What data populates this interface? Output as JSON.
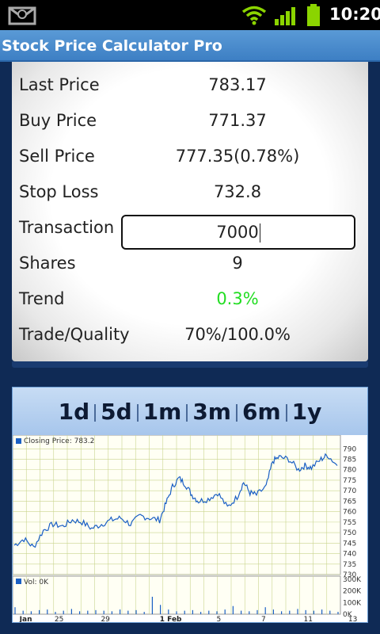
{
  "status_bar": {
    "time": "10:20",
    "icons": [
      "notification-icon",
      "wifi-icon",
      "signal-icon",
      "battery-icon"
    ]
  },
  "app": {
    "title": "Stock Price Calculator Pro"
  },
  "info": {
    "rows": [
      {
        "label": "Last Price",
        "value": "783.17"
      },
      {
        "label": "Buy Price",
        "value": "771.37"
      },
      {
        "label": "Sell Price",
        "value": "777.35(0.78%)"
      },
      {
        "label": "Stop Loss",
        "value": "732.8"
      },
      {
        "label": "Transaction",
        "value": "7000"
      },
      {
        "label": "Shares",
        "value": "9"
      },
      {
        "label": "Trend",
        "value": "0.3%",
        "color": "#22dd22"
      },
      {
        "label": "Trade/Quality",
        "value": "70%/100.0%"
      }
    ]
  },
  "ranges": [
    "1d",
    "5d",
    "1m",
    "3m",
    "6m",
    "1y"
  ],
  "chart_data": [
    {
      "type": "line",
      "title": "Closing Price: 783.2",
      "ylim": [
        730,
        792
      ],
      "yticks": [
        730,
        735,
        740,
        745,
        750,
        755,
        760,
        765,
        770,
        775,
        780,
        785,
        790
      ],
      "xtick_labels": [
        "Jan",
        "25",
        "29",
        "1 Feb",
        "5",
        "7",
        "11",
        "13"
      ],
      "grid": true,
      "x": [
        0,
        0.03,
        0.06,
        0.09,
        0.12,
        0.15,
        0.18,
        0.21,
        0.24,
        0.27,
        0.3,
        0.33,
        0.36,
        0.39,
        0.42,
        0.45,
        0.47,
        0.49,
        0.51,
        0.53,
        0.55,
        0.57,
        0.6,
        0.63,
        0.66,
        0.69,
        0.71,
        0.73,
        0.75,
        0.78,
        0.8,
        0.82,
        0.85,
        0.88,
        0.9,
        0.92,
        0.95,
        0.97,
        1.0
      ],
      "values": [
        744,
        747,
        743,
        751,
        754,
        753,
        756,
        755,
        752,
        754,
        756,
        757,
        754,
        758,
        757,
        756,
        764,
        772,
        776,
        773,
        768,
        765,
        766,
        769,
        762,
        767,
        774,
        769,
        768,
        772,
        784,
        786,
        785,
        780,
        782,
        781,
        785,
        787,
        782
      ]
    },
    {
      "type": "bar",
      "title": "Vol: 0K",
      "ylim": [
        0,
        300
      ],
      "yticks": [
        "0K",
        "100K",
        "200K",
        "300K"
      ],
      "values": [
        60,
        30,
        25,
        35,
        40,
        20,
        30,
        45,
        25,
        30,
        35,
        30,
        25,
        40,
        30,
        35,
        20,
        150,
        80,
        40,
        25,
        30,
        35,
        20,
        30,
        25,
        40,
        70,
        30,
        25,
        35,
        60,
        40,
        25,
        30,
        45,
        35,
        30,
        40,
        30,
        20
      ]
    }
  ]
}
